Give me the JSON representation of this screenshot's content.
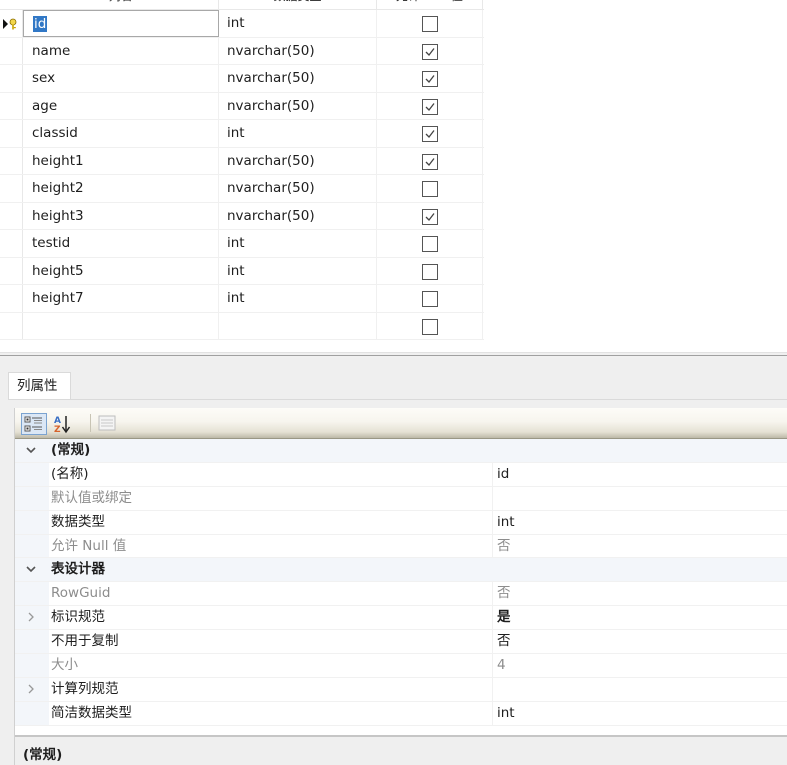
{
  "grid": {
    "headers": {
      "column_name": "列名",
      "data_type": "数据类型",
      "allow_null": "允许 Null 值"
    },
    "rows": [
      {
        "name": "id",
        "type": "int",
        "allow_null": false,
        "primary_key": true,
        "current": true
      },
      {
        "name": "name",
        "type": "nvarchar(50)",
        "allow_null": true
      },
      {
        "name": "sex",
        "type": "nvarchar(50)",
        "allow_null": true
      },
      {
        "name": "age",
        "type": "nvarchar(50)",
        "allow_null": true
      },
      {
        "name": "classid",
        "type": "int",
        "allow_null": true
      },
      {
        "name": "height1",
        "type": "nvarchar(50)",
        "allow_null": true
      },
      {
        "name": "height2",
        "type": "nvarchar(50)",
        "allow_null": false
      },
      {
        "name": "height3",
        "type": "nvarchar(50)",
        "allow_null": true
      },
      {
        "name": "testid",
        "type": "int",
        "allow_null": false
      },
      {
        "name": "height5",
        "type": "int",
        "allow_null": false
      },
      {
        "name": "height7",
        "type": "int",
        "allow_null": false
      },
      {
        "name": "",
        "type": "",
        "allow_null": false
      }
    ],
    "icons": {
      "row_indicator": "current-row-arrow-icon",
      "key": "primary-key-icon"
    }
  },
  "properties": {
    "tab_label": "列属性",
    "toolbar": {
      "categorized": "categorized-icon",
      "alphabetical": "sort-az-icon",
      "property_pages": "property-pages-icon"
    },
    "rows": [
      {
        "kind": "category",
        "expander": "expanded",
        "name": "(常规)"
      },
      {
        "kind": "prop",
        "name": "(名称)",
        "value": "id"
      },
      {
        "kind": "prop",
        "name": "默认值或绑定",
        "value": "",
        "dim": true
      },
      {
        "kind": "prop",
        "name": "数据类型",
        "value": "int"
      },
      {
        "kind": "prop",
        "name": "允许 Null 值",
        "value": "否",
        "dim": true
      },
      {
        "kind": "category",
        "expander": "expanded",
        "name": "表设计器"
      },
      {
        "kind": "prop",
        "name": "RowGuid",
        "value": "否",
        "dim": true
      },
      {
        "kind": "prop",
        "name": "标识规范",
        "value": "是",
        "expander": "collapsed",
        "bold_value": true
      },
      {
        "kind": "prop",
        "name": "不用于复制",
        "value": "否"
      },
      {
        "kind": "prop",
        "name": "大小",
        "value": "4",
        "dim": true
      },
      {
        "kind": "prop",
        "name": "计算列规范",
        "value": "",
        "expander": "collapsed"
      },
      {
        "kind": "prop",
        "name": "简洁数据类型",
        "value": "int"
      }
    ],
    "description_title": "(常规)"
  }
}
